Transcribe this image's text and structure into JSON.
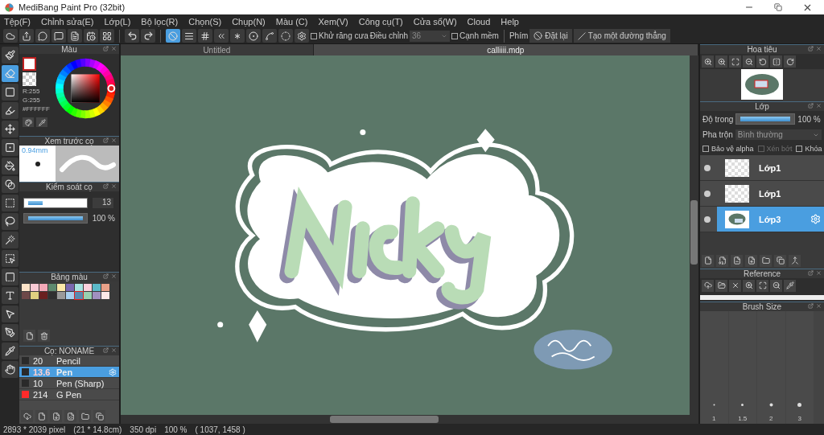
{
  "window": {
    "title": "MediBang Paint Pro (32bit)"
  },
  "menu": [
    "Tệp(F)",
    "Chỉnh sửa(E)",
    "Lớp(L)",
    "Bộ lọc(R)",
    "Chọn(S)",
    "Chụp(N)",
    "Màu (C)",
    "Xem(V)",
    "Công cụ(T)",
    "Cửa sổ(W)",
    "Cloud",
    "Help"
  ],
  "toolbar": {
    "snaps": [
      {
        "kind": "off",
        "selected": true
      },
      {
        "kind": "parallel",
        "selected": false
      },
      {
        "kind": "grid",
        "selected": false
      },
      {
        "kind": "fan",
        "selected": false
      },
      {
        "kind": "burst",
        "selected": false
      },
      {
        "kind": "rings",
        "selected": false
      },
      {
        "kind": "curve",
        "selected": false
      },
      {
        "kind": "ellipse",
        "selected": false
      }
    ],
    "antialias": {
      "label": "Khử răng cưa",
      "checked": false
    },
    "adjust_label": "Điều chỉnh",
    "adjust_value": "36",
    "soft_edge": {
      "label": "Cạnh mềm",
      "checked": false
    },
    "keys_label": "Phím",
    "reset": "Đặt lại",
    "line": "Tạo một đường thẳng"
  },
  "tools": [
    {
      "kind": "brush",
      "selected": false
    },
    {
      "kind": "eraser",
      "selected": true
    },
    {
      "kind": "rect",
      "selected": false
    },
    {
      "kind": "selbrush",
      "selected": false
    },
    {
      "kind": "move",
      "selected": false
    },
    {
      "kind": "fill",
      "selected": false
    },
    {
      "kind": "bucket",
      "selected": false
    },
    {
      "kind": "gradient",
      "selected": false
    },
    {
      "kind": "select",
      "selected": false
    },
    {
      "kind": "lasso",
      "selected": false
    },
    {
      "kind": "wand",
      "selected": false
    },
    {
      "kind": "selpen",
      "selected": false
    },
    {
      "kind": "selerase",
      "selected": false
    },
    {
      "kind": "text",
      "selected": false
    },
    {
      "kind": "pointer",
      "selected": false
    },
    {
      "kind": "knife",
      "selected": false
    },
    {
      "kind": "dropper",
      "selected": false
    },
    {
      "kind": "hand",
      "selected": false
    }
  ],
  "color_panel": {
    "title": "Màu",
    "r": "R:255",
    "g": "G:255",
    "hex": "#FFFFFF"
  },
  "brush_preview": {
    "title": "Xem trước cọ",
    "size": "0.94mm"
  },
  "brush_control": {
    "title": "Kiểm soát cọ",
    "size": {
      "level": 0.27,
      "value": "13"
    },
    "opacity": {
      "level": 1,
      "value": "100 %"
    }
  },
  "palette": {
    "title": "Bảng màu",
    "colors": [
      {
        "color": "#fde3c8",
        "selected": false
      },
      {
        "color": "#f9c9d4",
        "selected": false
      },
      {
        "color": "#f4a9b8",
        "selected": false
      },
      {
        "color": "#5e8a6e",
        "selected": false
      },
      {
        "color": "#fbe8a8",
        "selected": false
      },
      {
        "color": "#7a68b0",
        "selected": false
      },
      {
        "color": "#a6e3e0",
        "selected": false
      },
      {
        "color": "#fbd0dc",
        "selected": false
      },
      {
        "color": "#5cb8c8",
        "selected": false
      },
      {
        "color": "#e8a088",
        "selected": false
      },
      {
        "color": "#6e4848",
        "selected": false
      },
      {
        "color": "#e0d080",
        "selected": false
      },
      {
        "color": "#6a2020",
        "selected": false
      },
      {
        "color": "#303030",
        "selected": false
      },
      {
        "color": "#9a9a9a",
        "selected": false
      },
      {
        "color": "#a8d0f0",
        "selected": false
      },
      {
        "color": "#5a8ab0",
        "selected": true
      },
      {
        "color": "#98d0b0",
        "selected": false
      },
      {
        "color": "#a090c0",
        "selected": false
      },
      {
        "color": "#fde8e8",
        "selected": false
      }
    ]
  },
  "brushes": {
    "title": "Cọ: NONAME",
    "items": [
      {
        "size": "20",
        "name": "Pencil",
        "color": "#2a2a2a",
        "selected": false
      },
      {
        "size": "13.6",
        "name": "Pen",
        "color": "#2a2a2a",
        "selected": true
      },
      {
        "size": "10",
        "name": "Pen (Sharp)",
        "color": "#2a2a2a",
        "selected": false
      },
      {
        "size": "214",
        "name": "G Pen",
        "color": "#ff2a2a",
        "selected": false
      }
    ]
  },
  "documents": [
    {
      "label": "Untitled",
      "selected": false
    },
    {
      "label": "calliiii.mdp",
      "selected": true
    }
  ],
  "navigator": {
    "title": "Hoa tiêu"
  },
  "layers": {
    "title": "Lớp",
    "opacity_label": "Độ trong",
    "opacity": {
      "level": 1,
      "value": "100 %"
    },
    "blend_label": "Pha trộn",
    "blend_value": "Bình thường",
    "options": [
      {
        "label": "Bảo vệ alpha",
        "checked": false,
        "disabled": false
      },
      {
        "label": "Xén bớt",
        "checked": false,
        "disabled": true
      },
      {
        "label": "Khóa",
        "checked": false,
        "disabled": false
      }
    ],
    "items": [
      {
        "name": "Lớp1",
        "kind": "blank",
        "selected": false
      },
      {
        "name": "Lớp1",
        "kind": "blank",
        "selected": false
      },
      {
        "name": "Lớp3",
        "kind": "art",
        "selected": true
      }
    ]
  },
  "reference": {
    "title": "Reference"
  },
  "brush_size": {
    "title": "Brush Size",
    "sizes": [
      "1",
      "1.5",
      "2",
      "3"
    ]
  },
  "status_bar": [
    "2893 * 2039 pixel",
    "(21 * 14.8cm)",
    "350 dpi",
    "100 %",
    "( 1037, 1458 )"
  ]
}
